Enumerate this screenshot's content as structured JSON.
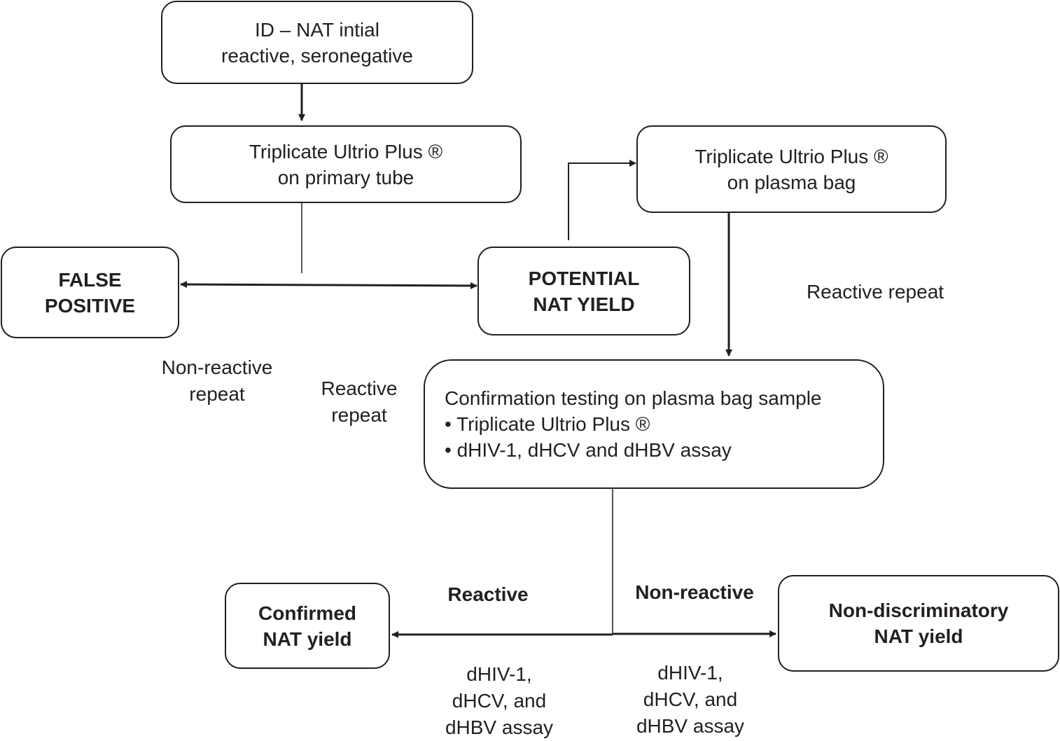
{
  "nodes": {
    "start": {
      "lines": [
        "ID – NAT intial",
        "reactive, seronegative"
      ]
    },
    "primary_tube": {
      "lines": [
        "Triplicate Ultrio Plus ®",
        "on primary tube"
      ]
    },
    "false_positive": {
      "lines": [
        "FALSE",
        "POSITIVE"
      ]
    },
    "potential_yield": {
      "lines": [
        "POTENTIAL",
        "NAT YIELD"
      ]
    },
    "plasma_bag": {
      "lines": [
        "Triplicate Ultrio Plus ®",
        "on plasma bag"
      ]
    },
    "confirmation": {
      "lines": [
        "Confirmation testing on plasma bag sample",
        "• Triplicate Ultrio Plus ®",
        "• dHIV-1, dHCV and dHBV assay"
      ]
    },
    "confirmed_yield": {
      "lines": [
        "Confirmed",
        "NAT yield"
      ]
    },
    "non_discriminatory": {
      "lines": [
        "Non-discriminatory",
        "NAT yield"
      ]
    }
  },
  "edge_labels": {
    "non_reactive_repeat": [
      "Non-reactive",
      "repeat"
    ],
    "reactive_repeat_left": [
      "Reactive",
      "repeat"
    ],
    "reactive_repeat_right": [
      "Reactive repeat"
    ],
    "reactive": [
      "Reactive"
    ],
    "non_reactive": [
      "Non-reactive"
    ],
    "assay_left": [
      "dHIV-1,",
      "dHCV, and",
      "dHBV assay"
    ],
    "assay_right": [
      "dHIV-1,",
      "dHCV, and",
      "dHBV assay"
    ]
  },
  "colors": {
    "ink": "#231f20",
    "background": "#ffffff"
  }
}
